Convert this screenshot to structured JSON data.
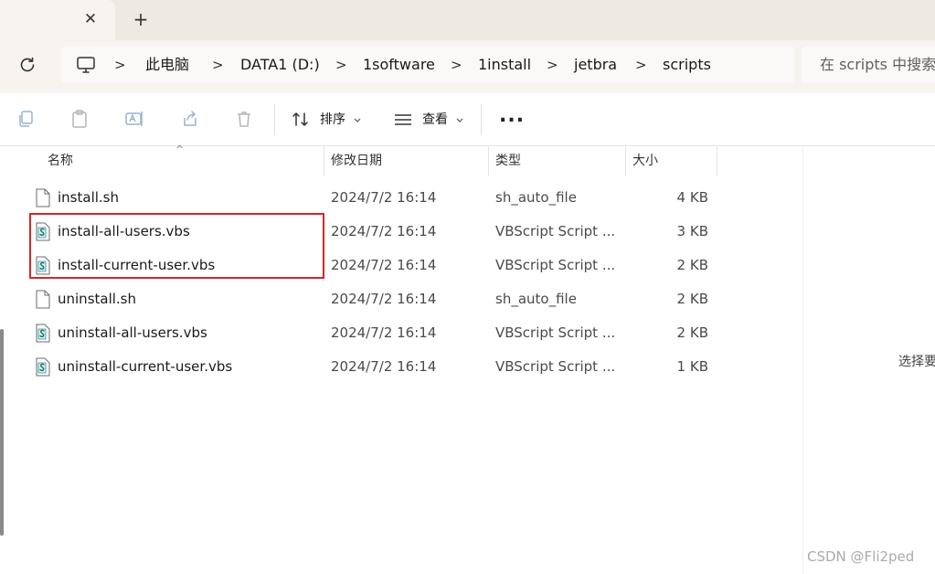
{
  "tab": {
    "close_glyph": "✕",
    "new_tab_glyph": "+"
  },
  "breadcrumb": {
    "items": [
      "此电脑",
      "DATA1 (D:)",
      "1software",
      "1install",
      "jetbra",
      "scripts"
    ],
    "separator": ">"
  },
  "search": {
    "placeholder": "在 scripts 中搜索"
  },
  "toolbar": {
    "sort_label": "排序",
    "view_label": "查看",
    "more_label": "..."
  },
  "columns": {
    "name": "名称",
    "modified": "修改日期",
    "type": "类型",
    "size": "大小"
  },
  "files": [
    {
      "name": "install.sh",
      "modified": "2024/7/2 16:14",
      "type": "sh_auto_file",
      "size": "4 KB",
      "icon": "blank-file-icon"
    },
    {
      "name": "install-all-users.vbs",
      "modified": "2024/7/2 16:14",
      "type": "VBScript Script ...",
      "size": "3 KB",
      "icon": "vbs-script-icon"
    },
    {
      "name": "install-current-user.vbs",
      "modified": "2024/7/2 16:14",
      "type": "VBScript Script ...",
      "size": "2 KB",
      "icon": "vbs-script-icon"
    },
    {
      "name": "uninstall.sh",
      "modified": "2024/7/2 16:14",
      "type": "sh_auto_file",
      "size": "2 KB",
      "icon": "blank-file-icon"
    },
    {
      "name": "uninstall-all-users.vbs",
      "modified": "2024/7/2 16:14",
      "type": "VBScript Script ...",
      "size": "2 KB",
      "icon": "vbs-script-icon"
    },
    {
      "name": "uninstall-current-user.vbs",
      "modified": "2024/7/2 16:14",
      "type": "VBScript Script ...",
      "size": "1 KB",
      "icon": "vbs-script-icon"
    }
  ],
  "preview": {
    "text": "选择要"
  },
  "watermark": "CSDN @Fli2ped",
  "colors": {
    "highlight": "#d42828",
    "tabstrip": "#efe9e3",
    "navrow": "#f7f3ef"
  }
}
